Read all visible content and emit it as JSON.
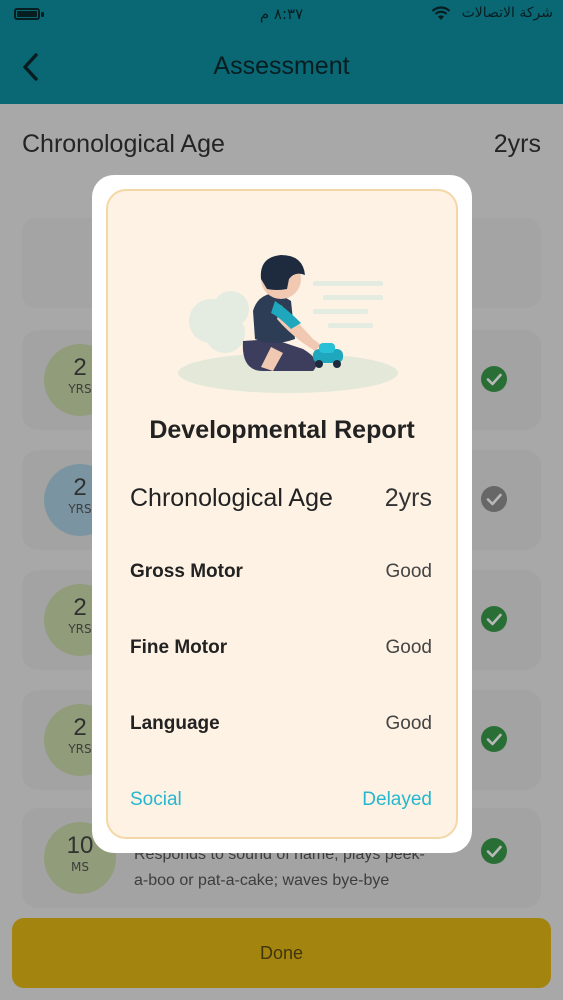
{
  "status_bar": {
    "time": "٨:٣٧ م",
    "carrier": "شركة الاتصالات"
  },
  "header": {
    "title": "Assessment"
  },
  "chronological_age": {
    "label": "Chronological Age",
    "value": "2yrs"
  },
  "milestone_cards": [
    {
      "age_num": "2",
      "age_unit": "YRS",
      "circle_color": "#c9d9a9",
      "status": "done"
    },
    {
      "age_num": "2",
      "age_unit": "YRS",
      "circle_color": "#a9cfe0",
      "status": "pending"
    },
    {
      "age_num": "2",
      "age_unit": "YRS",
      "circle_color": "#c9d9a9",
      "status": "done"
    },
    {
      "age_num": "2",
      "age_unit": "YRS",
      "circle_color": "#c9d9a9",
      "status": "done"
    },
    {
      "age_num": "10",
      "age_unit": "MS",
      "circle_color": "#c9d9a9",
      "status": "done",
      "description": "Responds to sound of name; plays peek-a-boo or pat-a-cake; waves bye-bye"
    }
  ],
  "done_button": {
    "label": "Done"
  },
  "report": {
    "heading": "Developmental Report",
    "age_label": "Chronological Age",
    "age_value": "2yrs",
    "rows": [
      {
        "label": "Gross Motor",
        "value": "Good"
      },
      {
        "label": "Fine Motor",
        "value": "Good"
      },
      {
        "label": "Language",
        "value": "Good"
      },
      {
        "label": "Social",
        "value": "Delayed"
      }
    ]
  },
  "colors": {
    "header_teal": "#0f8fa1",
    "accent_cyan": "#25b7cf",
    "done_yellow": "#e2b715",
    "check_green": "#3a9a4a",
    "modal_cream": "#fdf2e3"
  }
}
